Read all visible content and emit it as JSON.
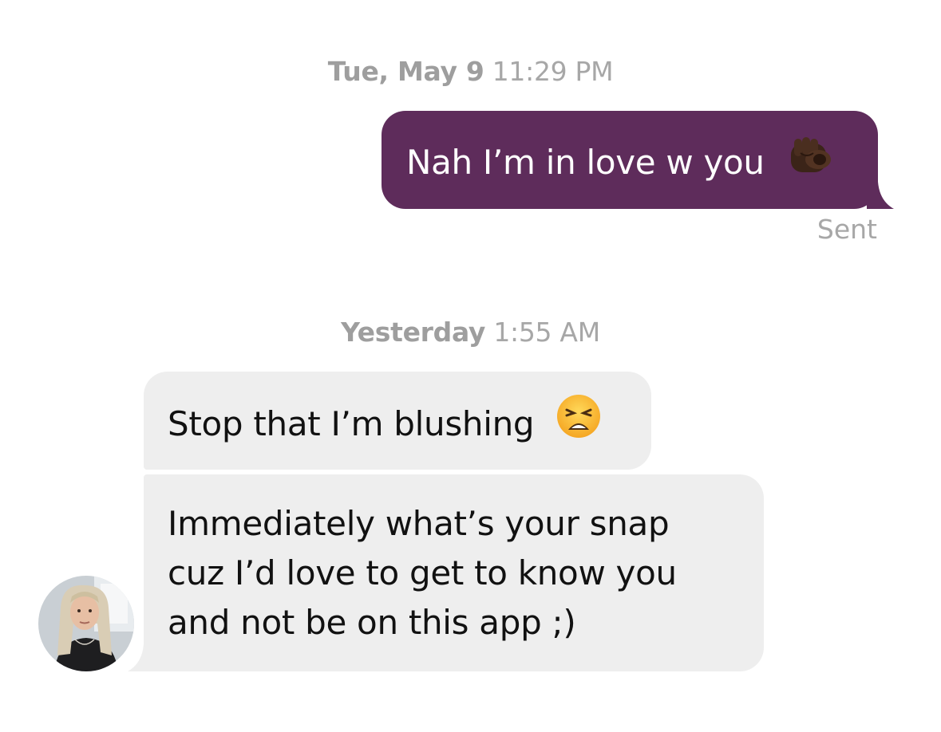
{
  "conversation": {
    "timestamp_1": {
      "day": "Tue, May 9",
      "time": "11:29 PM"
    },
    "timestamp_2": {
      "day": "Yesterday",
      "time": "1:55 AM"
    },
    "outgoing": {
      "text": "Nah I’m in love w you",
      "emoji": "pointing-at-viewer-emoji",
      "status": "Sent"
    },
    "incoming": [
      {
        "text": "Stop that I’m blushing",
        "emoji": "weary-face-emoji"
      },
      {
        "lines": [
          "Immediately what’s your snap",
          "cuz I’d love to get to know you",
          "and not be on this app ;)"
        ]
      }
    ],
    "avatar_icon": "profile-photo"
  },
  "colors": {
    "outgoing_bubble": "#5e2c5b",
    "incoming_bubble": "#eeeeee",
    "timestamp_text": "#a7a7a7"
  }
}
